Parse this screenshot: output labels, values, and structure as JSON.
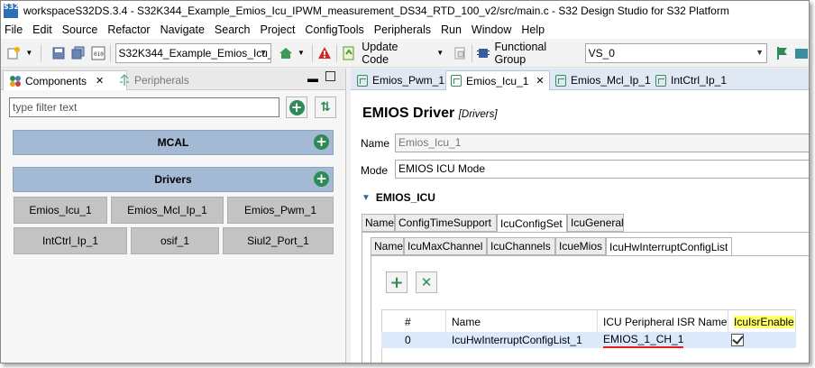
{
  "window": {
    "title": "workspaceS32DS.3.4 - S32K344_Example_Emios_Icu_IPWM_measurement_DS34_RTD_100_v2/src/main.c - S32 Design Studio for S32 Platform",
    "app_icon_text": "S32"
  },
  "menu": [
    "File",
    "Edit",
    "Source",
    "Refactor",
    "Navigate",
    "Search",
    "Project",
    "ConfigTools",
    "Peripherals",
    "Run",
    "Window",
    "Help"
  ],
  "toolbar": {
    "project_combo": "S32K344_Example_Emios_Icu_IPW",
    "update_code_label": "Update Code",
    "functional_group_label": "Functional Group",
    "functional_group_value": "VS_0"
  },
  "left_panel": {
    "tabs": [
      "Components",
      "Peripherals"
    ],
    "filter_placeholder": "type filter text",
    "groups": [
      {
        "label": "MCAL",
        "items": []
      },
      {
        "label": "Drivers",
        "items": [
          "Emios_Icu_1",
          "Emios_Mcl_Ip_1",
          "Emios_Pwm_1",
          "IntCtrl_Ip_1",
          "osif_1",
          "Siul2_Port_1"
        ]
      }
    ]
  },
  "editor": {
    "tabs": [
      "Emios_Pwm_1",
      "Emios_Icu_1",
      "Emios_Mcl_Ip_1",
      "IntCtrl_Ip_1"
    ],
    "active_tab_index": 1,
    "heading": "EMIOS Driver",
    "heading_sub": "[Drivers]",
    "name_label": "Name",
    "name_value": "Emios_Icu_1",
    "mode_label": "Mode",
    "mode_value": "EMIOS ICU Mode",
    "section": "EMIOS_ICU",
    "tabs_level1": [
      "Name",
      "ConfigTimeSupport",
      "IcuConfigSet",
      "IcuGeneral"
    ],
    "tabs_level2": [
      "Name",
      "IcuMaxChannel",
      "IcuChannels",
      "IcueMios",
      "IcuHwInterruptConfigList"
    ],
    "table": {
      "headers": [
        "#",
        "Name",
        "ICU Peripheral ISR Name",
        "IcuIsrEnable"
      ],
      "rows": [
        {
          "index": "0",
          "name": "IcuHwInterruptConfigList_1",
          "isr": "EMIOS_1_CH_1",
          "enabled": true
        }
      ]
    }
  },
  "colors": {
    "group_bar": "#a3b9d4",
    "component_button": "#c3c3c3",
    "highlight_header": "#ffff66",
    "selected_row": "#dbe9fb",
    "underline": "#e02020"
  }
}
